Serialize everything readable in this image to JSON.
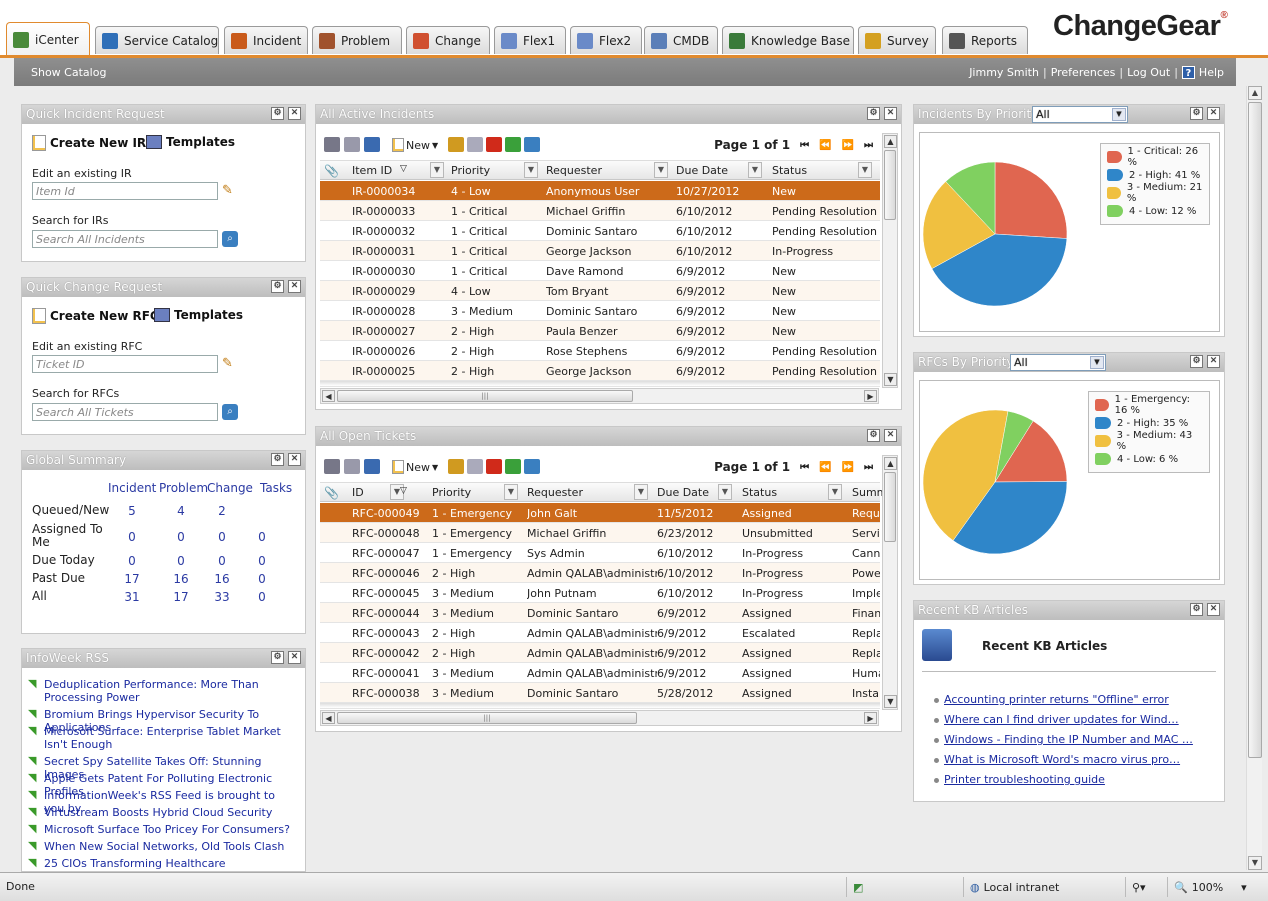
{
  "tabs": [
    {
      "label": "iCenter",
      "icon": "icenter-icon",
      "color": "#4a8a3a",
      "active": true
    },
    {
      "label": "Service Catalog",
      "icon": "service-catalog-icon",
      "color": "#2f6fb8"
    },
    {
      "label": "Incident",
      "icon": "incident-icon",
      "color": "#c95a1a"
    },
    {
      "label": "Problem",
      "icon": "problem-icon",
      "color": "#a0522d"
    },
    {
      "label": "Change",
      "icon": "change-icon",
      "color": "#d05030"
    },
    {
      "label": "Flex1",
      "icon": "flex1-icon",
      "color": "#6a8ac8"
    },
    {
      "label": "Flex2",
      "icon": "flex2-icon",
      "color": "#6a8ac8"
    },
    {
      "label": "CMDB",
      "icon": "cmdb-icon",
      "color": "#5b7fb8"
    },
    {
      "label": "Knowledge Base",
      "icon": "knowledge-base-icon",
      "color": "#3a7a3a"
    },
    {
      "label": "Survey",
      "icon": "survey-icon",
      "color": "#d4a020"
    },
    {
      "label": "Reports",
      "icon": "reports-icon",
      "color": "#555555"
    }
  ],
  "logo": {
    "text": "ChangeGear",
    "reg": "®"
  },
  "graybar": {
    "show_catalog": "Show Catalog",
    "user": "Jimmy Smith",
    "preferences": "Preferences",
    "logout": "Log Out",
    "help": "Help",
    "help_glyph": "?",
    "sep": "|"
  },
  "qir": {
    "title": "Quick Incident Request",
    "create": "Create New IR",
    "templates": "Templates",
    "edit_label": "Edit an existing IR",
    "edit_placeholder": "Item Id",
    "search_label": "Search for IRs",
    "search_placeholder": "Search All Incidents"
  },
  "qcr": {
    "title": "Quick Change Request",
    "create": "Create New RFC",
    "templates": "Templates",
    "edit_label": "Edit an existing RFC",
    "edit_placeholder": "Ticket ID",
    "search_label": "Search for RFCs",
    "search_placeholder": "Search All Tickets"
  },
  "gs": {
    "title": "Global Summary",
    "headers": [
      "Incident",
      "Problem",
      "Change",
      "Tasks"
    ],
    "rows": [
      {
        "label": "Queued/New",
        "values": [
          "5",
          "4",
          "2",
          ""
        ]
      },
      {
        "label": "Assigned To Me",
        "values": [
          "0",
          "0",
          "0",
          "0"
        ]
      },
      {
        "label": "Due Today",
        "values": [
          "0",
          "0",
          "0",
          "0"
        ]
      },
      {
        "label": "Past Due",
        "values": [
          "17",
          "16",
          "16",
          "0"
        ]
      },
      {
        "label": "All",
        "values": [
          "31",
          "17",
          "33",
          "0"
        ]
      }
    ]
  },
  "rss": {
    "title": "InfoWeek RSS",
    "items": [
      "Deduplication Performance: More Than Processing Power",
      "Bromium Brings Hypervisor Security To Applications",
      "Microsoft Surface: Enterprise Tablet Market Isn't Enough",
      "Secret Spy Satellite Takes Off: Stunning Images",
      "Apple Gets Patent For Polluting Electronic Profiles",
      "InformationWeek's RSS Feed is brought to you by",
      "Virtustream Boosts Hybrid Cloud Security",
      "Microsoft Surface Too Pricey For Consumers?",
      "When New Social Networks, Old Tools Clash",
      "25 CIOs Transforming Healthcare"
    ]
  },
  "incidents": {
    "title": "All Active Incidents",
    "new_label": "New",
    "page": "Page 1 of 1",
    "headers": [
      "Item ID",
      "Priority",
      "Requester",
      "Due Date",
      "Status"
    ],
    "rows": [
      [
        "IR-0000034",
        "4 - Low",
        "Anonymous User",
        "10/27/2012",
        "New"
      ],
      [
        "IR-0000033",
        "1 - Critical",
        "Michael Griffin",
        "6/10/2012",
        "Pending Resolution"
      ],
      [
        "IR-0000032",
        "1 - Critical",
        "Dominic Santaro",
        "6/10/2012",
        "Pending Resolution"
      ],
      [
        "IR-0000031",
        "1 - Critical",
        "George Jackson",
        "6/10/2012",
        "In-Progress"
      ],
      [
        "IR-0000030",
        "1 - Critical",
        "Dave Ramond",
        "6/9/2012",
        "New"
      ],
      [
        "IR-0000029",
        "4 - Low",
        "Tom Bryant",
        "6/9/2012",
        "New"
      ],
      [
        "IR-0000028",
        "3 - Medium",
        "Dominic Santaro",
        "6/9/2012",
        "New"
      ],
      [
        "IR-0000027",
        "2 - High",
        "Paula Benzer",
        "6/9/2012",
        "New"
      ],
      [
        "IR-0000026",
        "2 - High",
        "Rose Stephens",
        "6/9/2012",
        "Pending Resolution"
      ],
      [
        "IR-0000025",
        "2 - High",
        "George Jackson",
        "6/9/2012",
        "Pending Resolution"
      ]
    ]
  },
  "tickets": {
    "title": "All Open Tickets",
    "new_label": "New",
    "page": "Page 1 of 1",
    "headers": [
      "ID",
      "Priority",
      "Requester",
      "Due Date",
      "Status",
      "Summa"
    ],
    "rows": [
      [
        "RFC-000049",
        "1 - Emergency",
        "John Galt",
        "11/5/2012",
        "Assigned",
        "Reque"
      ],
      [
        "RFC-000048",
        "1 - Emergency",
        "Michael Griffin",
        "6/23/2012",
        "Unsubmitted",
        "Service"
      ],
      [
        "RFC-000047",
        "1 - Emergency",
        "Sys Admin",
        "6/10/2012",
        "In-Progress",
        "Canno"
      ],
      [
        "RFC-000046",
        "2 - High",
        "Admin QALAB\\administrator",
        "6/10/2012",
        "In-Progress",
        "Power"
      ],
      [
        "RFC-000045",
        "3 - Medium",
        "John Putnam",
        "6/10/2012",
        "In-Progress",
        "Implem"
      ],
      [
        "RFC-000044",
        "3 - Medium",
        "Dominic Santaro",
        "6/9/2012",
        "Assigned",
        "Financ"
      ],
      [
        "RFC-000043",
        "2 - High",
        "Admin QALAB\\administrator",
        "6/9/2012",
        "Escalated",
        "Replac"
      ],
      [
        "RFC-000042",
        "2 - High",
        "Admin QALAB\\administrator",
        "6/9/2012",
        "Assigned",
        "Replac"
      ],
      [
        "RFC-000041",
        "3 - Medium",
        "Admin QALAB\\administrator",
        "6/9/2012",
        "Assigned",
        "Human"
      ],
      [
        "RFC-000038",
        "3 - Medium",
        "Dominic Santaro",
        "5/28/2012",
        "Assigned",
        "Install"
      ]
    ]
  },
  "ibp": {
    "title": "Incidents By Priority",
    "filter": "All"
  },
  "rbp": {
    "title": "RFCs By Priority",
    "filter": "All"
  },
  "chart_data": [
    {
      "type": "pie",
      "title": "",
      "categories": [
        "1 - Critical",
        "2 - High",
        "3 - Medium",
        "4 - Low"
      ],
      "values": [
        26,
        41,
        21,
        12
      ],
      "colors": [
        "#e06650",
        "#2f86c9",
        "#f0c040",
        "#80d060"
      ]
    },
    {
      "type": "pie",
      "title": "",
      "categories": [
        "1 - Emergency",
        "2 - High",
        "3 - Medium",
        "4 - Low"
      ],
      "values": [
        16,
        35,
        43,
        6
      ],
      "colors": [
        "#e06650",
        "#2f86c9",
        "#f0c040",
        "#80d060"
      ]
    }
  ],
  "kb": {
    "title": "Recent KB Articles",
    "heading": "Recent KB Articles",
    "items": [
      "Accounting printer returns \"Offline\" error",
      "Where can I find driver updates for Wind…",
      "Windows - Finding the IP Number and MAC …",
      "What is Microsoft Word's macro virus pro…",
      "Printer troubleshooting guide"
    ]
  },
  "status": {
    "done": "Done",
    "zone": "Local intranet",
    "zoom": "100%"
  }
}
